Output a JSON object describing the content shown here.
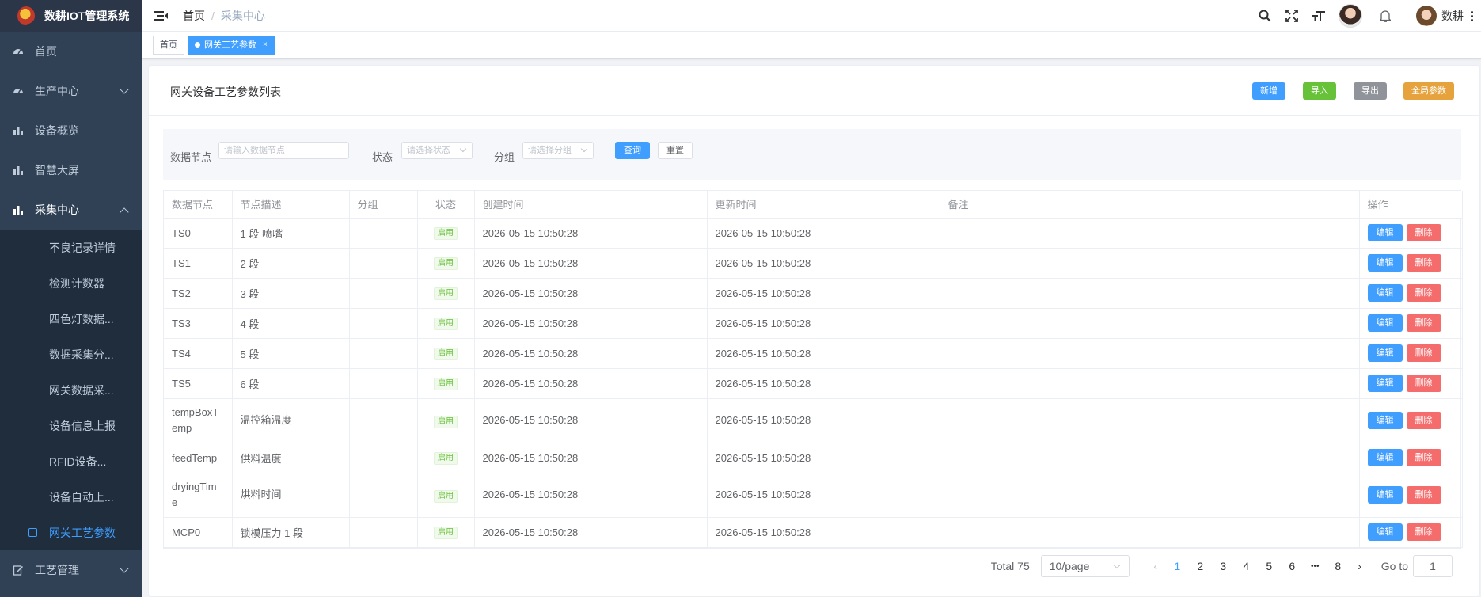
{
  "app": {
    "title": "数耕IOT管理系统"
  },
  "sidebar": {
    "items": [
      {
        "label": "首页",
        "icon": "dashboard-icon",
        "has_children": false
      },
      {
        "label": "生产中心",
        "icon": "dashboard-icon",
        "has_children": true,
        "expanded": false
      },
      {
        "label": "设备概览",
        "icon": "bar-chart-icon",
        "has_children": false
      },
      {
        "label": "智慧大屏",
        "icon": "bar-chart-icon",
        "has_children": false
      },
      {
        "label": "采集中心",
        "icon": "bar-chart-icon",
        "has_children": true,
        "expanded": true
      }
    ],
    "submenu": [
      {
        "label": "不良记录详情"
      },
      {
        "label": "检测计数器"
      },
      {
        "label": "四色灯数据..."
      },
      {
        "label": "数据采集分..."
      },
      {
        "label": "网关数据采..."
      },
      {
        "label": "设备信息上报"
      },
      {
        "label": "RFID设备..."
      },
      {
        "label": "设备自动上..."
      },
      {
        "label": "网关工艺参数",
        "active": true
      }
    ],
    "after": {
      "label": "工艺管理",
      "icon": "edit-doc-icon",
      "has_children": true
    }
  },
  "navbar": {
    "breadcrumb": {
      "home": "首页",
      "separator": "/",
      "current": "采集中心"
    },
    "icons": [
      "search-icon",
      "fullscreen-icon",
      "font-size-icon",
      "notification-bell-icon"
    ],
    "user_name": "数耕"
  },
  "tags": [
    {
      "label": "首页",
      "active": false
    },
    {
      "label": "网关工艺参数",
      "active": true,
      "close": "×"
    }
  ],
  "card": {
    "title": "网关设备工艺参数列表",
    "buttons": {
      "add": "新增",
      "import": "导入",
      "export": "导出",
      "global": "全局参数"
    }
  },
  "search": {
    "node_label": "数据节点",
    "node_placeholder": "请输入数据节点",
    "status_label": "状态",
    "status_placeholder": "请选择状态",
    "group_label": "分组",
    "group_placeholder": "请选择分组",
    "query": "查询",
    "reset": "重置"
  },
  "table": {
    "columns": [
      "数据节点",
      "节点描述",
      "分组",
      "状态",
      "创建时间",
      "更新时间",
      "备注",
      "操作"
    ],
    "edit_label": "编辑",
    "delete_label": "删除",
    "rows": [
      {
        "node": "TS0",
        "desc": "1 段 喷嘴",
        "group": "",
        "status": "启用",
        "created": "2026-05-15 10:50:28",
        "updated": "2026-05-15 10:50:28",
        "remark": ""
      },
      {
        "node": "TS1",
        "desc": "2 段",
        "group": "",
        "status": "启用",
        "created": "2026-05-15 10:50:28",
        "updated": "2026-05-15 10:50:28",
        "remark": ""
      },
      {
        "node": "TS2",
        "desc": "3 段",
        "group": "",
        "status": "启用",
        "created": "2026-05-15 10:50:28",
        "updated": "2026-05-15 10:50:28",
        "remark": ""
      },
      {
        "node": "TS3",
        "desc": "4 段",
        "group": "",
        "status": "启用",
        "created": "2026-05-15 10:50:28",
        "updated": "2026-05-15 10:50:28",
        "remark": ""
      },
      {
        "node": "TS4",
        "desc": "5 段",
        "group": "",
        "status": "启用",
        "created": "2026-05-15 10:50:28",
        "updated": "2026-05-15 10:50:28",
        "remark": ""
      },
      {
        "node": "TS5",
        "desc": "6 段",
        "group": "",
        "status": "启用",
        "created": "2026-05-15 10:50:28",
        "updated": "2026-05-15 10:50:28",
        "remark": ""
      },
      {
        "node": "tempBoxTemp",
        "node_lines": [
          "tempBoxT",
          "emp"
        ],
        "desc": "温控箱温度",
        "group": "",
        "status": "启用",
        "created": "2026-05-15 10:50:28",
        "updated": "2026-05-15 10:50:28",
        "remark": ""
      },
      {
        "node": "feedTemp",
        "desc": "供料温度",
        "group": "",
        "status": "启用",
        "created": "2026-05-15 10:50:28",
        "updated": "2026-05-15 10:50:28",
        "remark": ""
      },
      {
        "node": "dryingTime",
        "node_lines": [
          "dryingTim",
          "e"
        ],
        "desc": "烘料时间",
        "group": "",
        "status": "启用",
        "created": "2026-05-15 10:50:28",
        "updated": "2026-05-15 10:50:28",
        "remark": ""
      },
      {
        "node": "MCP0",
        "desc": "锁模压力 1 段",
        "group": "",
        "status": "启用",
        "created": "2026-05-15 10:50:28",
        "updated": "2026-05-15 10:50:28",
        "remark": ""
      }
    ]
  },
  "pagination": {
    "total": "Total 75",
    "page_size": "10/page",
    "pages": [
      "1",
      "2",
      "3",
      "4",
      "5",
      "6",
      "•••",
      "8"
    ],
    "current": "1",
    "goto_label": "Go to",
    "goto_value": "1"
  },
  "colors": {
    "sidebar_bg": "#304156",
    "primary": "#409eff",
    "success": "#67c23a",
    "info": "#909399",
    "warning": "#e6a23c",
    "danger": "#f56c6c"
  }
}
